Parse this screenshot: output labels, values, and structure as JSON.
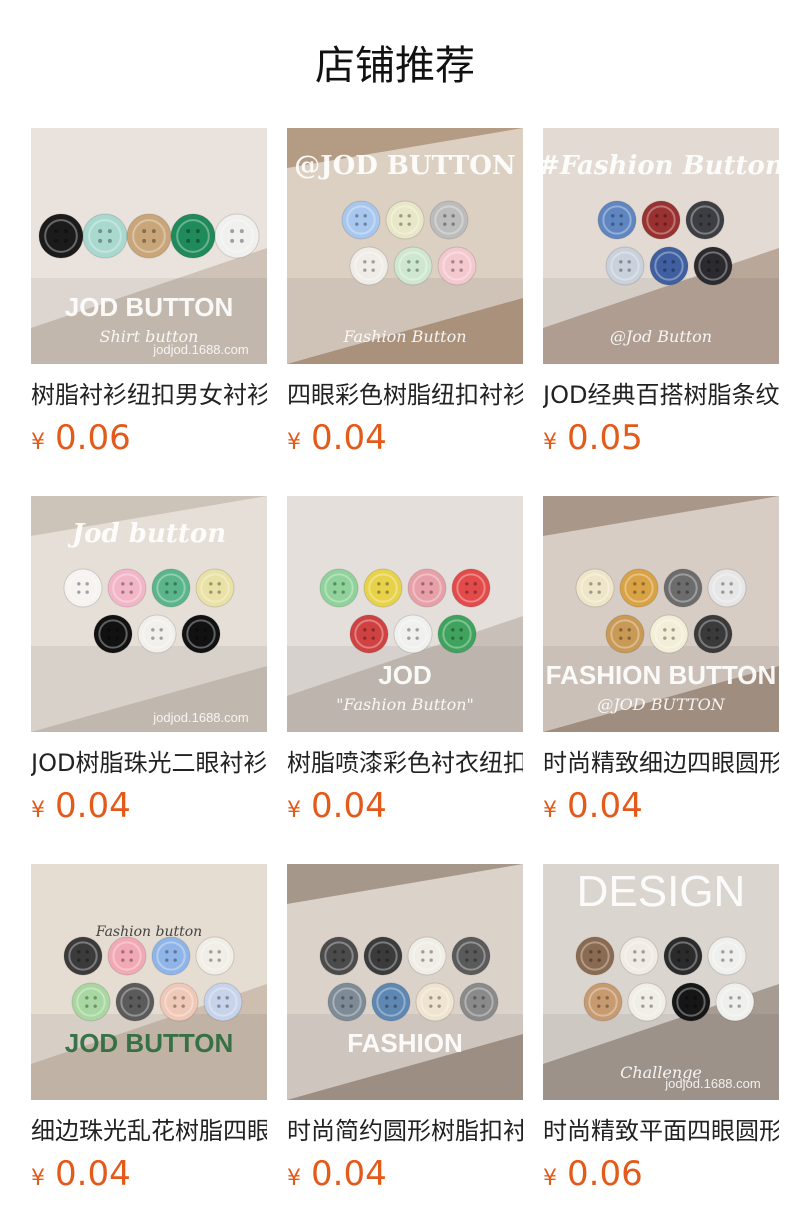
{
  "header": {
    "title": "店铺推荐"
  },
  "colors": {
    "price": "#e35a1a",
    "title": "#111111",
    "text": "#222222"
  },
  "products": [
    {
      "name": "树脂衬衫纽扣男女衬衫",
      "currency": "¥",
      "price": "0.06",
      "image": {
        "bg": "#cfc3b7",
        "accent": "#f3eee9",
        "big": "JOD  BUTTON",
        "small": "Shirt  button",
        "store": "jodjod.1688.com",
        "buttons": [
          "#1b1b1b",
          "#a9d8cf",
          "#c9a679",
          "#1f8a5a",
          "#f0f0ee"
        ]
      }
    },
    {
      "name": "四眼彩色树脂纽扣衬衫",
      "currency": "¥",
      "price": "0.04",
      "image": {
        "bg": "#b49b84",
        "accent": "#e9e2d8",
        "big": "@JOD BUTTON",
        "small": "Fashion Button",
        "store": "",
        "buttons": [
          "#a8c7ee",
          "#e8e7c8",
          "#bcbcbc",
          "#f0ede8",
          "#cfe7cf",
          "#f3c9cf"
        ]
      }
    },
    {
      "name": "JOD经典百搭树脂条纹",
      "currency": "¥",
      "price": "0.05",
      "image": {
        "bg": "#b9a79a",
        "accent": "#f1ece6",
        "big": "#Fashion Button",
        "small": "@Jod Button",
        "store": "",
        "buttons": [
          "#5f86c0",
          "#9a3131",
          "#3d3d44",
          "#c9d1dc",
          "#3f5fa0",
          "#2a2a2f"
        ]
      }
    },
    {
      "name": "JOD树脂珠光二眼衬衫",
      "currency": "¥",
      "price": "0.04",
      "image": {
        "bg": "#cdc4b9",
        "accent": "#ede8e2",
        "big": "Jod button",
        "small": "",
        "store": "jodjod.1688.com",
        "buttons": [
          "#f6f3f0",
          "#f2b6c8",
          "#5bb58b",
          "#e9e1a5",
          "#111111",
          "#f2f0ec",
          "#111111"
        ]
      }
    },
    {
      "name": "树脂喷漆彩色衬衣纽扣",
      "currency": "¥",
      "price": "0.04",
      "image": {
        "bg": "#c8c0b8",
        "accent": "#eeeae6",
        "big": "JOD",
        "small": "\"Fashion Button\"",
        "store": "",
        "buttons": [
          "#8fd29a",
          "#e8d24a",
          "#e8a0a8",
          "#e34b4b",
          "#d04242",
          "#f0f0ee",
          "#3fa35e"
        ]
      }
    },
    {
      "name": "时尚精致细边四眼圆形",
      "currency": "¥",
      "price": "0.04",
      "image": {
        "bg": "#a99789",
        "accent": "#e7dfd8",
        "big": "FASHION  BUTTON",
        "small": "@JOD BUTTON",
        "store": "",
        "buttons": [
          "#efe6c9",
          "#d9a244",
          "#6c6c6c",
          "#e6e6e6",
          "#c99a56",
          "#f3eed8",
          "#3a3a3a"
        ]
      }
    },
    {
      "name": "细边珠光乱花树脂四眼",
      "currency": "¥",
      "price": "0.04",
      "image": {
        "bg": "#cdbeb0",
        "accent": "#ece5dd",
        "big": "JOD BUTTON",
        "small": "Fashion button",
        "store": "",
        "buttons": [
          "#3b3b3b",
          "#f2a9b6",
          "#8fb5e8",
          "#f0eee6",
          "#a9d7a1",
          "#5b5b5b",
          "#f0c8b8",
          "#c6d3ea"
        ]
      }
    },
    {
      "name": "时尚简约圆形树脂扣衬衫",
      "currency": "¥",
      "price": "0.04",
      "image": {
        "bg": "#a6978b",
        "accent": "#ece6df",
        "big": "FASHION",
        "small": "",
        "store": "",
        "buttons": [
          "#4b4b4b",
          "#3b3b3b",
          "#f0ede6",
          "#5a5a5a",
          "#7d8b96",
          "#5e87b2",
          "#efe4cf",
          "#8a8a8a"
        ]
      }
    },
    {
      "name": "时尚精致平面四眼圆形",
      "currency": "¥",
      "price": "0.06",
      "image": {
        "bg": "#a79c92",
        "accent": "#ece8e3",
        "big": "DESIGN",
        "small": "Challenge",
        "store": "jodjod.1688.com",
        "buttons": [
          "#8a6a50",
          "#f1ece3",
          "#2b2b2b",
          "#efefed",
          "#c79a70",
          "#f1eee8",
          "#161616",
          "#efefec"
        ]
      }
    }
  ]
}
